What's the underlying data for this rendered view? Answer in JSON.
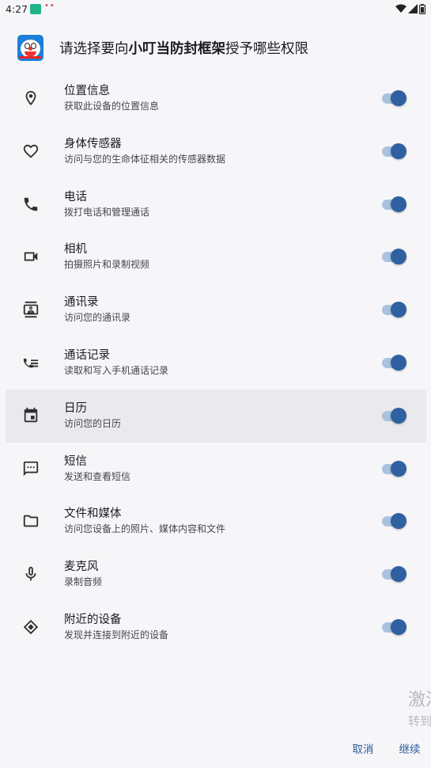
{
  "status_bar": {
    "time": "4:27",
    "notification_dots": "••",
    "icons": [
      "wifi-icon",
      "signal-icon",
      "battery-icon"
    ]
  },
  "header": {
    "prefix": "请选择要向",
    "app_name": "小叮当防封框架",
    "suffix": "授予哪些权限"
  },
  "permissions": [
    {
      "icon": "location-icon",
      "title": "位置信息",
      "desc": "获取此设备的位置信息",
      "enabled": true
    },
    {
      "icon": "heart-icon",
      "title": "身体传感器",
      "desc": "访问与您的生命体征相关的传感器数据",
      "enabled": true
    },
    {
      "icon": "phone-icon",
      "title": "电话",
      "desc": "拨打电话和管理通话",
      "enabled": true
    },
    {
      "icon": "camera-icon",
      "title": "相机",
      "desc": "拍摄照片和录制视频",
      "enabled": true
    },
    {
      "icon": "contacts-icon",
      "title": "通讯录",
      "desc": "访问您的通讯录",
      "enabled": true
    },
    {
      "icon": "call-log-icon",
      "title": "通话记录",
      "desc": "读取和写入手机通话记录",
      "enabled": true
    },
    {
      "icon": "calendar-icon",
      "title": "日历",
      "desc": "访问您的日历",
      "enabled": true
    },
    {
      "icon": "sms-icon",
      "title": "短信",
      "desc": "发送和查看短信",
      "enabled": true
    },
    {
      "icon": "folder-icon",
      "title": "文件和媒体",
      "desc": "访问您设备上的照片、媒体内容和文件",
      "enabled": true
    },
    {
      "icon": "microphone-icon",
      "title": "麦克风",
      "desc": "录制音频",
      "enabled": true
    },
    {
      "icon": "nearby-devices-icon",
      "title": "附近的设备",
      "desc": "发现并连接到附近的设备",
      "enabled": true
    }
  ],
  "watermark": {
    "line1": "激活",
    "line2": "转到"
  },
  "footer": {
    "cancel_label": "取消",
    "continue_label": "继续"
  },
  "colors": {
    "background": "#f6f6f9",
    "accent": "#2f60a0",
    "toggle_track": "#a9c2de",
    "button_text": "#2c5d9c"
  }
}
